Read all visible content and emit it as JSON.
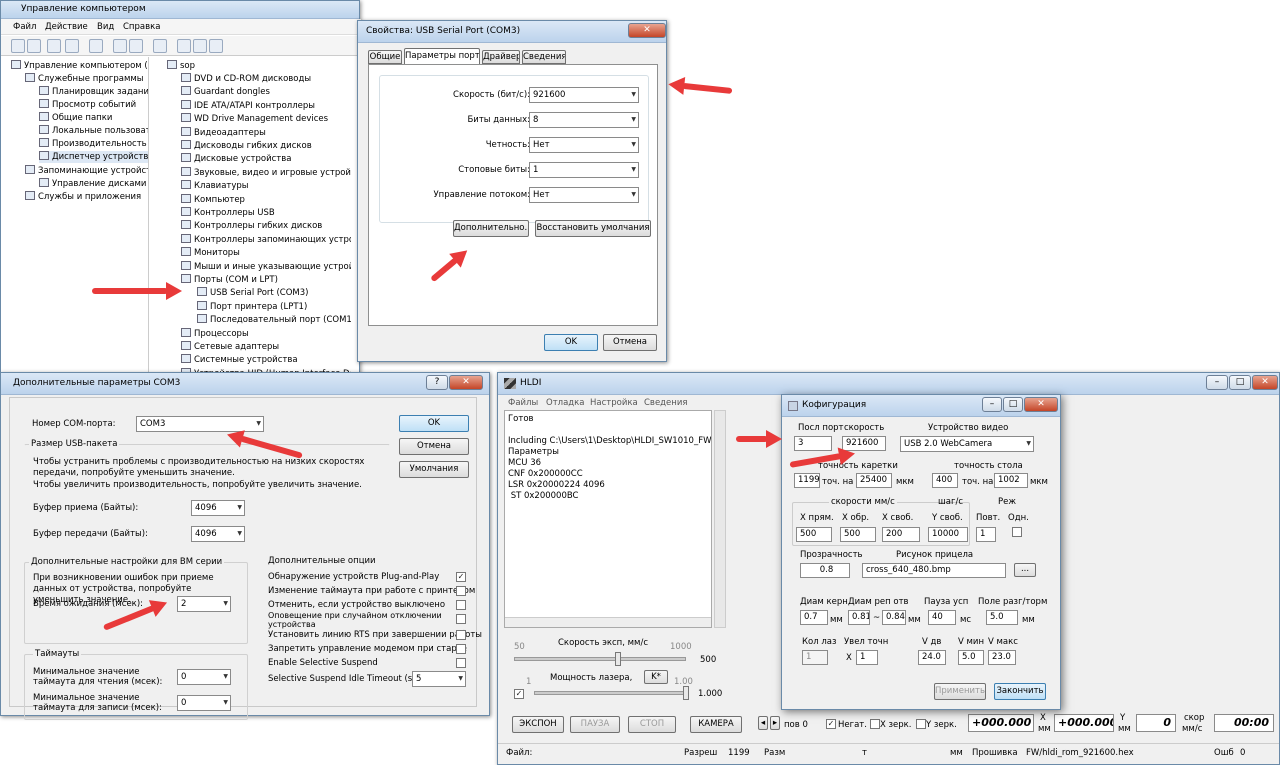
{
  "cm": {
    "title": "Управление компьютером",
    "menu": [
      "Файл",
      "Действие",
      "Вид",
      "Справка"
    ],
    "left_tree": [
      "Управление компьютером (л",
      "Служебные программы",
      "Планировщик заданий",
      "Просмотр событий",
      "Общие папки",
      "Локальные пользовате",
      "Производительность",
      "Диспетчер устройств",
      "Запоминающие устройст",
      "Управление дисками",
      "Службы и приложения"
    ],
    "root": "sop",
    "devices": [
      "DVD и CD-ROM дисководы",
      "Guardant dongles",
      "IDE ATA/ATAPI контроллеры",
      "WD Drive Management devices",
      "Видеоадаптеры",
      "Дисководы гибких дисков",
      "Дисковые устройства",
      "Звуковые, видео и игровые устройст",
      "Клавиатуры",
      "Компьютер",
      "Контроллеры USB",
      "Контроллеры гибких дисков",
      "Контроллеры запоминающих устрой",
      "Мониторы",
      "Мыши и иные указывающие устрой",
      "Порты (COM и LPT)",
      "USB Serial Port (COM3)",
      "Порт принтера (LPT1)",
      "Последовательный порт (COM1)",
      "Процессоры",
      "Сетевые адаптеры",
      "Системные устройства",
      "Устройства HID (Human Interface Dev",
      "Хост-адаптеры запоминающих устройств"
    ]
  },
  "props": {
    "title": "Свойства: USB Serial Port (COM3)",
    "tabs": [
      "Общие",
      "Параметры порта",
      "Драйвер",
      "Сведения"
    ],
    "fields": [
      {
        "label": "Скорость (бит/с):",
        "value": "921600"
      },
      {
        "label": "Биты данных:",
        "value": "8"
      },
      {
        "label": "Четность:",
        "value": "Нет"
      },
      {
        "label": "Стоповые биты:",
        "value": "1"
      },
      {
        "label": "Управление потоком:",
        "value": "Нет"
      }
    ],
    "advanced": "Дополнительно...",
    "restore": "Восстановить умолчания",
    "ok": "OK",
    "cancel": "Отмена"
  },
  "adv": {
    "title": "Дополнительные параметры COM3",
    "port_label": "Номер COM-порта:",
    "port_value": "COM3",
    "usb_group": "Размер USB-пакета",
    "usb_text1": "Чтобы устранить проблемы с производительностью на низких скоростях передачи, попробуйте уменьшить значение.",
    "usb_text2": "Чтобы увеличить производительность, попробуйте увеличить значение.",
    "rx_label": "Буфер приема (Байты):",
    "rx_value": "4096",
    "tx_label": "Буфер передачи (Байты):",
    "tx_value": "4096",
    "bm_group": "Дополнительные настройки для BM серии",
    "bm_text": "При возникновении ошибок при приеме данных от устройства, попробуйте уменьшить значение.",
    "wait_label": "Время ожидания (мсек):",
    "wait_value": "2",
    "timeouts_group": "Таймауты",
    "min_read_label": "Минимальное значение таймаута для чтения (мсек):",
    "min_read_value": "0",
    "min_write_label": "Минимальное значение таймаута для записи (мсек):",
    "min_write_value": "0",
    "options_group": "Дополнительные опции",
    "options": [
      {
        "label": "Обнаружение устройств Plug-and-Play",
        "checked": "✓"
      },
      {
        "label": "Изменение таймаута при работе с принтером",
        "checked": ""
      },
      {
        "label": "Отменить, если устройство выключено",
        "checked": ""
      },
      {
        "label": "Оповещение при случайном отключении устройства",
        "checked": ""
      },
      {
        "label": "Установить линию RTS при завершении работы",
        "checked": ""
      },
      {
        "label": "Запретить управление модемом при старте",
        "checked": ""
      },
      {
        "label": "Enable Selective Suspend",
        "checked": ""
      }
    ],
    "suspend_label": "Selective Suspend Idle Timeout (secs):",
    "suspend_value": "5",
    "ok": "OK",
    "cancel": "Отмена",
    "defaults": "Умолчания"
  },
  "hldi": {
    "title": "HLDI",
    "menu": [
      "Файлы",
      "Отладка",
      "Настройка",
      "Сведения"
    ],
    "log": [
      "Готов",
      "",
      "Including C:\\Users\\1\\Desktop\\HLDI_SW1010_FW",
      "Параметры",
      "MCU 36",
      "CNF 0x200000CC",
      "LSR 0x20000224 4096",
      " ST 0x200000BC"
    ],
    "speed_label": "Скорость эксп, мм/с",
    "speed_min": "50",
    "speed_max": "1000",
    "speed_value": "500",
    "speed_fraction": 0.6,
    "power_label": "Мощность лазера,",
    "k_btn": "K*",
    "power_min": "1",
    "power_max": "1.00",
    "power_value": "1.000",
    "power_fraction": 1.0,
    "buttons": [
      "ЭКСПОН",
      "ПАУЗА",
      "СТОП",
      "КАМЕРА"
    ],
    "bottom": {
      "pos": "пов 0",
      "neg": "Негат.",
      "xmirror": "X зерк.",
      "ymirror": "Y зерк.",
      "x_value": "+000.000",
      "x_unit1": "X",
      "x_unit2": "мм",
      "y_value": "+000.000",
      "y_unit1": "Y",
      "y_unit2": "мм",
      "z_value": "0",
      "speed_unit1": "скор",
      "speed_unit2": "мм/с",
      "time": "00:00"
    },
    "status": {
      "file": "Файл:",
      "res": "Разреш",
      "res_val": "1199",
      "size": "Разм",
      "t": "т",
      "mm": "мм",
      "fw_label": "Прошивка",
      "fw": "FW/hldi_rom_921600.hex",
      "err": "Ошб",
      "err_val": "0"
    }
  },
  "cfg": {
    "title": "Кофигурация",
    "port_label": "Посл порт",
    "port_value": "3",
    "speed_label": "скорость",
    "speed_value": "921600",
    "video_label": "Устройство видео",
    "video_value": "USB 2.0 WebCamera",
    "carriage_label": "точность каретки",
    "carriage_dpi": "1199",
    "tochmm": "точ. на",
    "carriage_val": "25400",
    "mkm": "мкм",
    "table_label": "точность стола",
    "table_dpi": "400",
    "table_val": "1002",
    "speeds_label": "скорости мм/с",
    "step_label": "шаг/с",
    "mode_label": "Реж",
    "xpr_label": "X прям.",
    "xpr": "500",
    "xobr_label": "X обр.",
    "xobr": "500",
    "xsv_label": "X своб.",
    "xsv": "200",
    "ysv_label": "Y своб.",
    "ysv": "10000",
    "povt_label": "Повт.",
    "povt": "1",
    "odn_label": "Одн.",
    "transp_label": "Прозрачность",
    "transp": "0.8",
    "crosshair_label": "Рисунок прицела",
    "crosshair": "cross_640_480.bmp",
    "browse": "...",
    "diam_core_label": "Диам керн",
    "diam_core": "0.7",
    "mm": "мм",
    "diam_rep_label": "Диам реп отв",
    "diam_rep1": "0.810",
    "dash": "~",
    "diam_rep2": "0.84",
    "pause_label": "Пауза усп",
    "pause": "40",
    "ms": "мс",
    "field_label": "Поле разг/торм",
    "field": "5.0",
    "kol_label": "Кол лаз",
    "kol": "1",
    "zoom_label": "Увел точн",
    "zoom_x": "X",
    "zoom": "1",
    "vdv_label": "V дв",
    "vdv": "24.0",
    "vmin_label": "V мин",
    "vmin": "5.0",
    "vmax_label": "V макс",
    "vmax": "23.0",
    "apply": "Применить",
    "finish": "Закончить"
  }
}
